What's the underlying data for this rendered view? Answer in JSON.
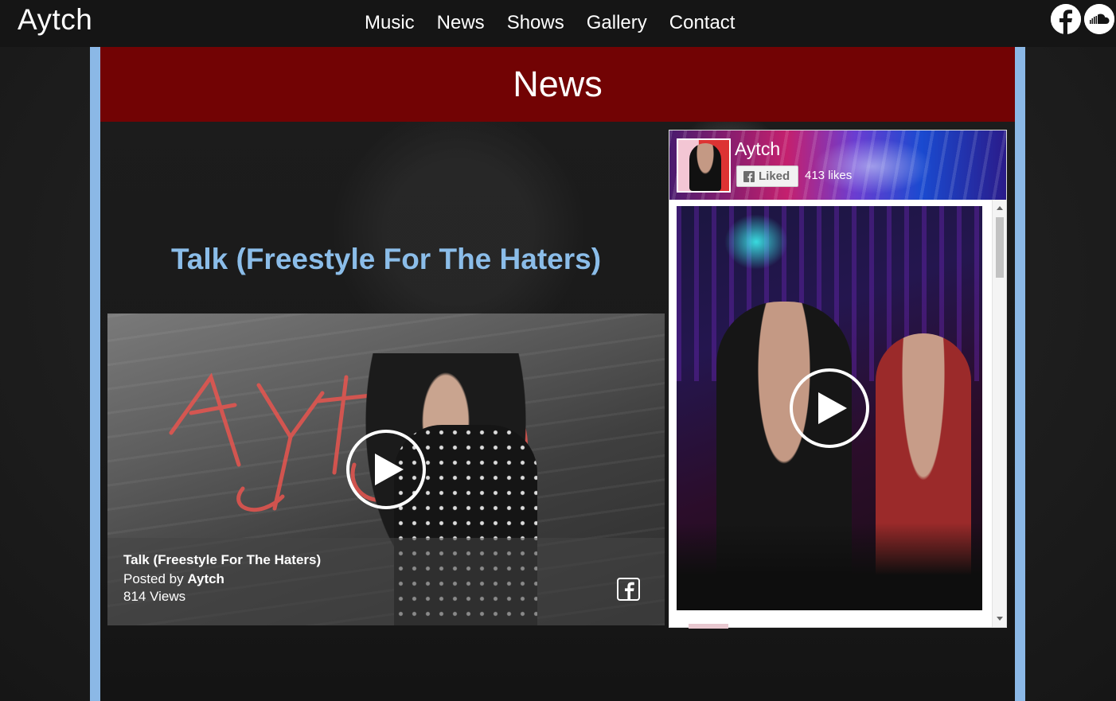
{
  "header": {
    "brand": "Aytch",
    "nav": [
      "Music",
      "News",
      "Shows",
      "Gallery",
      "Contact"
    ],
    "social_icons": [
      "facebook-icon",
      "soundcloud-icon"
    ]
  },
  "banner": {
    "title": "News"
  },
  "post": {
    "title": "Talk (Freestyle For The Haters)",
    "video": {
      "caption_title": "Talk (Freestyle For The Haters)",
      "posted_by_prefix": "Posted by",
      "posted_by_name": "Aytch",
      "views": "814 Views",
      "play_icon": "play-icon",
      "share_icon": "facebook-share-icon"
    }
  },
  "facebook_widget": {
    "page_name": "Aytch",
    "liked_label": "Liked",
    "likes": "413 likes",
    "feed_play_icon": "play-icon"
  },
  "colors": {
    "banner": "#720304",
    "frame": "#8bb8e6",
    "post_title": "#8bbde9",
    "topbar": "#151515"
  }
}
